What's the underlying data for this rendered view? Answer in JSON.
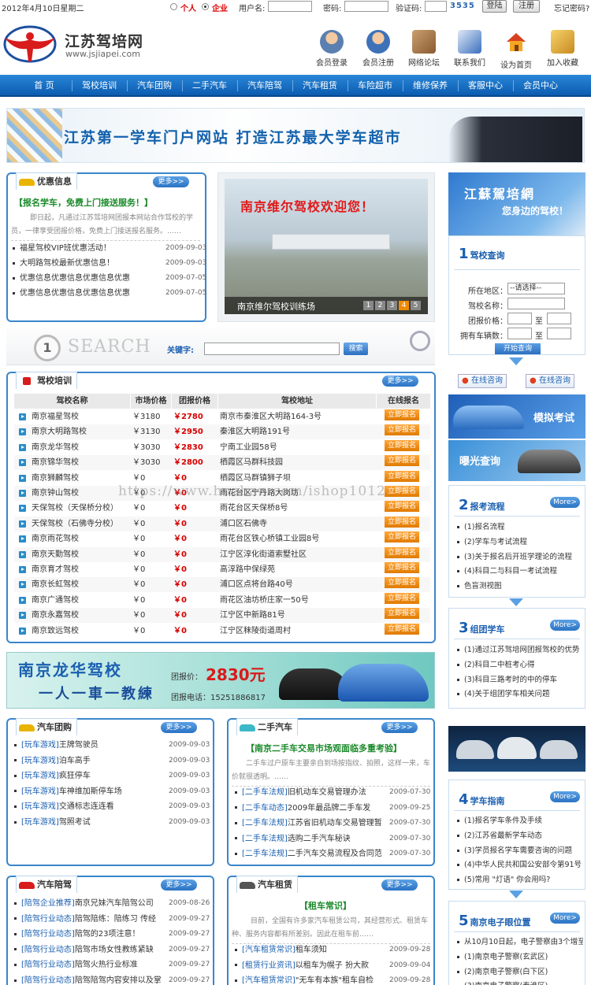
{
  "topbar": {
    "date": "2012年4月10日星期二",
    "radio_personal": "个人",
    "radio_company": "企业",
    "username_label": "用户名:",
    "password_label": "密码:",
    "captcha_label": "验证码:",
    "captcha_code": "3535",
    "login_button": "登陆",
    "register_button": "注册",
    "forgot_link": "忘记密码?"
  },
  "header": {
    "site_name": "江苏驾培网",
    "site_url": "www.jsjiapei.com",
    "icons": [
      {
        "label": "会员登录",
        "icon": "member-login-icon",
        "color": "#5b7fb0"
      },
      {
        "label": "会员注册",
        "icon": "member-register-icon",
        "color": "#3d72b8"
      },
      {
        "label": "网络论坛",
        "icon": "forum-icon",
        "color": "#a07040"
      },
      {
        "label": "联系我们",
        "icon": "contact-icon",
        "color": "#3a6fbf"
      },
      {
        "label": "设为首页",
        "icon": "home-icon",
        "color": "#d84020"
      },
      {
        "label": "加入收藏",
        "icon": "favorite-icon",
        "color": "#c88a20"
      }
    ]
  },
  "nav": [
    "首  页",
    "驾校培训",
    "汽车团购",
    "二手汽车",
    "汽车陪驾",
    "汽车租赁",
    "车险超市",
    "维修保养",
    "客服中心",
    "会员中心"
  ],
  "banner": {
    "text": "江苏第一学车门户网站  打造江苏最大学车超市"
  },
  "offers": {
    "title": "优惠信息",
    "more": "更多>>",
    "headline": "【报名学车，免费上门接送服务！】",
    "intro": "即日起，凡通过江苏驾培网团报本网站合作驾校的学员，一律享受团报价格，免费上门接送报名服务。……",
    "items": [
      {
        "text": "福星驾校VIP班优惠活动！",
        "date": "2009-09-03"
      },
      {
        "text": "大明路驾校最新优惠信息！",
        "date": "2009-09-03"
      },
      {
        "text": "优惠信息优惠信息优惠信息优惠",
        "date": "2009-07-05"
      },
      {
        "text": "优惠信息优惠信息优惠信息优惠",
        "date": "2009-07-05"
      }
    ]
  },
  "slideshow": {
    "headline": "南京维尔驾校欢迎您！",
    "caption": "南京维尔驾校训练场",
    "pages": [
      "1",
      "2",
      "3",
      "4",
      "5"
    ],
    "active_page": "4"
  },
  "search": {
    "logo_text": "SEARCH",
    "logo_number": "1",
    "keyword_label": "关键字:",
    "button": "搜索"
  },
  "schools": {
    "title": "驾校培训",
    "more": "更多>>",
    "columns": [
      "驾校名称",
      "市场价格",
      "团报价格",
      "驾校地址",
      "在线报名"
    ],
    "signup_label": "立即报名",
    "rows": [
      {
        "name": "南京福星驾校",
        "market": "￥3180",
        "group": "￥2780",
        "address": "南京市秦淮区大明路164-3号"
      },
      {
        "name": "南京大明路驾校",
        "market": "￥3130",
        "group": "￥2950",
        "address": "秦淮区大明路191号"
      },
      {
        "name": "南京龙华驾校",
        "market": "￥3030",
        "group": "￥2830",
        "address": "宁南工业园58号"
      },
      {
        "name": "南京锦华驾校",
        "market": "￥3030",
        "group": "￥2800",
        "address": "栖霞区马群科技园"
      },
      {
        "name": "南京狮麟驾校",
        "market": "￥0",
        "group": "￥0",
        "address": "栖霞区马群镇狮子坝"
      },
      {
        "name": "南京钟山驾校",
        "market": "￥0",
        "group": "￥0",
        "address": "雨花台区宁丹路大岗坊"
      },
      {
        "name": "天保驾校（天保桥分校）",
        "market": "￥0",
        "group": "￥0",
        "address": "雨花台区天保桥8号"
      },
      {
        "name": "天保驾校（石佛寺分校）",
        "market": "￥0",
        "group": "￥0",
        "address": "浦口区石佛寺"
      },
      {
        "name": "南京雨花驾校",
        "market": "￥0",
        "group": "￥0",
        "address": "雨花台区铁心桥镇工业园8号"
      },
      {
        "name": "南京天勤驾校",
        "market": "￥0",
        "group": "￥0",
        "address": "江宁区淳化街道索墅社区"
      },
      {
        "name": "南京育才驾校",
        "market": "￥0",
        "group": "￥0",
        "address": "高淳路中保绿苑"
      },
      {
        "name": "南京长虹驾校",
        "market": "￥0",
        "group": "￥0",
        "address": "浦口区点将台路40号"
      },
      {
        "name": "南京广通驾校",
        "market": "￥0",
        "group": "￥0",
        "address": "雨花区油坊桥庄家一50号"
      },
      {
        "name": "南京永嘉驾校",
        "market": "￥0",
        "group": "￥0",
        "address": "江宁区中新路81号"
      },
      {
        "name": "南京致远驾校",
        "market": "￥0",
        "group": "￥0",
        "address": "江宁区秣陵街道周村"
      }
    ]
  },
  "watermark": "https://www.huzhan.com/ishop1012",
  "ad_banner": {
    "title": "南京龙华驾校",
    "slogan": "一人一車一教練",
    "price_label": "团报价：",
    "price": "2830元",
    "phone": "团报电话：15251886817"
  },
  "group_buy": {
    "title": "汽车团购",
    "more": "更多>>",
    "items": [
      {
        "cat": "[玩车游戏]",
        "text": "王牌驾驶员",
        "date": "2009-09-03"
      },
      {
        "cat": "[玩车游戏]",
        "text": "泊车高手",
        "date": "2009-09-03"
      },
      {
        "cat": "[玩车游戏]",
        "text": "疯狂停车",
        "date": "2009-09-03"
      },
      {
        "cat": "[玩车游戏]",
        "text": "车神维加斯停车场",
        "date": "2009-09-03"
      },
      {
        "cat": "[玩车游戏]",
        "text": "交通标志连连看",
        "date": "2009-09-03"
      },
      {
        "cat": "[玩车游戏]",
        "text": "驾照考试",
        "date": "2009-09-03"
      }
    ]
  },
  "used_cars": {
    "title": "二手汽车",
    "more": "更多>>",
    "headline": "【南京二手车交易市场观面临多重考验】",
    "intro": "二手车过户原车主要亲自到场按指纹、拍照，这样一来，车价就很透明。……",
    "items": [
      {
        "cat": "[二手车法规]",
        "text": "旧机动车交易管理办法",
        "date": "2009-07-30"
      },
      {
        "cat": "[二手车动态]",
        "text": "2009年最品牌二手车发",
        "date": "2009-09-25"
      },
      {
        "cat": "[二手车法规]",
        "text": "江苏省旧机动车交易管理暂",
        "date": "2009-07-30"
      },
      {
        "cat": "[二手车法规]",
        "text": "选购二手汽车秘诀",
        "date": "2009-07-30"
      },
      {
        "cat": "[二手车法规]",
        "text": "二手汽车交易流程及合同范",
        "date": "2009-07-30"
      }
    ]
  },
  "chauffeur": {
    "title": "汽车陪驾",
    "more": "更多>>",
    "items": [
      {
        "cat": "[陪驾企业推荐]",
        "text": "南京兄妹汽车陪驾公司",
        "date": "2009-08-26"
      },
      {
        "cat": "[陪驾行业动态]",
        "text": "陪驾陪练：陪练习 传经",
        "date": "2009-09-27"
      },
      {
        "cat": "[陪驾行业动态]",
        "text": "陪驾的23项注意！",
        "date": "2009-09-27"
      },
      {
        "cat": "[陪驾行业动态]",
        "text": "陪驾市场女性教练紧缺",
        "date": "2009-09-27"
      },
      {
        "cat": "[陪驾行业动态]",
        "text": "陪驾火热行业标准",
        "date": "2009-09-27"
      },
      {
        "cat": "[陪驾行业动态]",
        "text": "陪驾陪驾内容安排以及掌",
        "date": "2009-09-27"
      }
    ]
  },
  "rental": {
    "title": "汽车租赁",
    "more": "更多>>",
    "headline": "【租车常识】",
    "intro": "目前，全国有许多家汽车租赁公司，其经营形式、租赁车种、服务内容都有所差别。因此在租车前……",
    "items": [
      {
        "cat": "[汽车租赁常识]",
        "text": "租车须知",
        "date": "2009-09-28"
      },
      {
        "cat": "[租赁行业资讯]",
        "text": "以租车为幌子 扮大款",
        "date": "2009-09-04"
      },
      {
        "cat": "[汽车租赁常识]",
        "text": "\"无车有本族\"租车自检",
        "date": "2009-09-28"
      }
    ]
  },
  "right": {
    "promo_title": "江蘇駕培網",
    "promo_sub": "您身边的驾校！",
    "query": {
      "num": "1",
      "title": "驾校查询",
      "region_label": "所在地区：",
      "region_value": "--请选择--",
      "name_label": "驾校名称：",
      "price_label": "团报价格：",
      "cars_label": "拥有车辆数：",
      "to": "至",
      "button": "开始查询"
    },
    "consult": [
      "在线咨询",
      "在线咨询"
    ],
    "mock_exam": "模拟考试",
    "exposure": "曝光查询",
    "process": {
      "num": "2",
      "title": "报考流程",
      "more": "More>",
      "items": [
        "(1)报名流程",
        "(2)学车与考试流程",
        "(3)关于报名后开班学理论的流程",
        "(4)科目二与科目一考试流程",
        "色盲测视图"
      ]
    },
    "groupteam": {
      "num": "3",
      "title": "组团学车",
      "more": "More>",
      "items": [
        "(1)通过江苏驾培网团报驾校的优势",
        "(2)科目二中桩考心得",
        "(3)科目三路考时的中的停车",
        "(4)关于组团学车相关问题"
      ]
    },
    "guide": {
      "num": "4",
      "title": "学车指南",
      "more": "More>",
      "items": [
        "(1)报名学车条件及手续",
        "(2)江苏省最新学车动态",
        "(3)学员报名学车需要咨询的问题",
        "(4)中华人民共和国公安部令第91号",
        "(5)常用 \"灯语\" 你会用吗?"
      ]
    },
    "speed": {
      "num": "5",
      "title": "南京电子眼位置",
      "more": "More>",
      "items": [
        "从10月10日起，电子警察由3个增至",
        "(1)南京电子警察(玄武区)",
        "(2)南京电子警察(白下区)",
        "(3)南京电子警察(秦淮区)"
      ]
    }
  }
}
